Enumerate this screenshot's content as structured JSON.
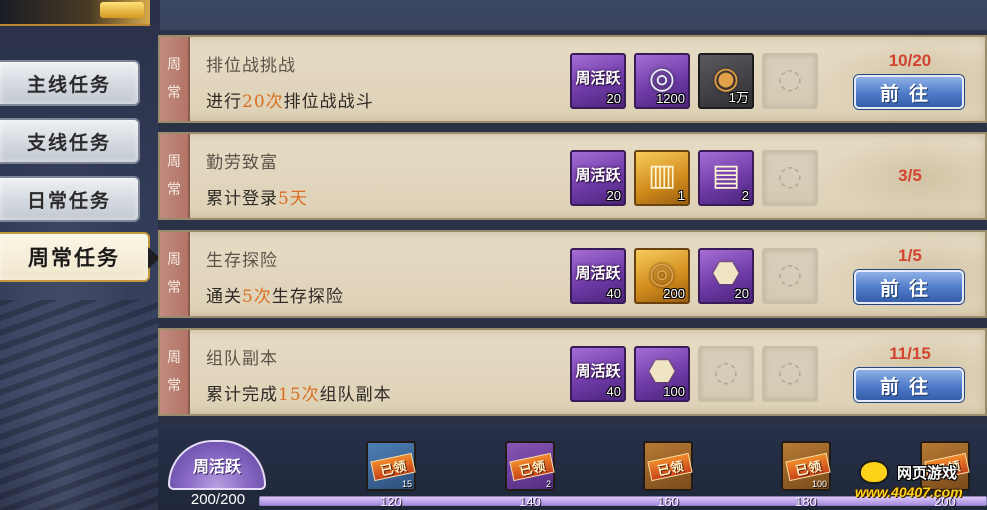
{
  "sidebar": {
    "items": [
      {
        "label": "主线任务"
      },
      {
        "label": "支线任务"
      },
      {
        "label": "日常任务"
      },
      {
        "label": "周常任务"
      }
    ]
  },
  "tasks": [
    {
      "tag": [
        "周",
        "常"
      ],
      "title": "排位战挑战",
      "desc_pre": "进行",
      "desc_num": "20次",
      "desc_post": "排位战战斗",
      "rewards": [
        {
          "type": "purple",
          "label": "周活跃",
          "qty": "20"
        },
        {
          "type": "purple",
          "icon": "silver-coin-icon",
          "qty": "1200"
        },
        {
          "type": "dark",
          "icon": "copper-coin-icon",
          "qty": "1万"
        },
        {
          "type": "empty"
        }
      ],
      "progress": "10/20",
      "go_label": "前往"
    },
    {
      "tag": [
        "周",
        "常"
      ],
      "title": "勤劳致富",
      "desc_pre": "累计登录",
      "desc_num": "5天",
      "desc_post": "",
      "rewards": [
        {
          "type": "purple",
          "label": "周活跃",
          "qty": "20"
        },
        {
          "type": "gold",
          "icon": "scroll-icon",
          "qty": "1"
        },
        {
          "type": "purple",
          "icon": "scrolls-icon",
          "qty": "2"
        },
        {
          "type": "empty"
        }
      ],
      "progress": "3/5",
      "go_label": ""
    },
    {
      "tag": [
        "周",
        "常"
      ],
      "title": "生存探险",
      "desc_pre": "通关",
      "desc_num": "5次",
      "desc_post": "生存探险",
      "rewards": [
        {
          "type": "purple",
          "label": "周活跃",
          "qty": "40"
        },
        {
          "type": "gold",
          "icon": "gold-coin-icon",
          "qty": "200"
        },
        {
          "type": "purple",
          "icon": "stone-icon",
          "qty": "20"
        },
        {
          "type": "empty"
        }
      ],
      "progress": "1/5",
      "go_label": "前往"
    },
    {
      "tag": [
        "周",
        "常"
      ],
      "title": "组队副本",
      "desc_pre": "累计完成",
      "desc_num": "15次",
      "desc_post": "组队副本",
      "rewards": [
        {
          "type": "purple",
          "label": "周活跃",
          "qty": "40"
        },
        {
          "type": "purple",
          "icon": "stone-icon",
          "qty": "100"
        },
        {
          "type": "empty"
        },
        {
          "type": "empty"
        }
      ],
      "progress": "11/15",
      "go_label": "前往"
    }
  ],
  "activity": {
    "label": "周活跃",
    "value": "200/200",
    "progress_fraction": 1.0,
    "milestones": [
      {
        "label": "120",
        "claimed_text": "已领",
        "qty": "15",
        "color": "blue"
      },
      {
        "label": "140",
        "claimed_text": "已领",
        "qty": "2",
        "color": "purple"
      },
      {
        "label": "160",
        "claimed_text": "已领",
        "qty": "",
        "color": "orange"
      },
      {
        "label": "180",
        "claimed_text": "已领",
        "qty": "100",
        "color": "orange"
      },
      {
        "label": "200",
        "claimed_text": "已领",
        "qty": "",
        "color": "orange"
      }
    ]
  },
  "watermark": {
    "line1": "网页游戏",
    "line2": "www.40407.com"
  }
}
